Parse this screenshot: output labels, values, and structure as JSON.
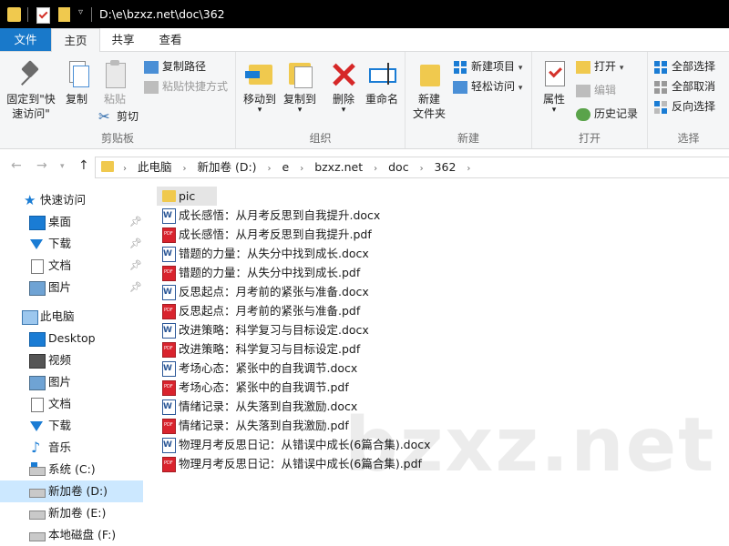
{
  "titlebar": {
    "path": "D:\\e\\bzxz.net\\doc\\362"
  },
  "tabs": [
    "文件",
    "主页",
    "共享",
    "查看"
  ],
  "ribbon": {
    "clipboard": {
      "label": "剪贴板",
      "pin": "固定到\"快\n速访问\"",
      "copy": "复制",
      "paste": "粘贴",
      "copy_path": "复制路径",
      "paste_shortcut": "粘贴快捷方式",
      "cut": "剪切"
    },
    "organize": {
      "label": "组织",
      "move_to": "移动到",
      "copy_to": "复制到",
      "delete": "删除",
      "rename": "重命名"
    },
    "new": {
      "label": "新建",
      "new_folder": "新建\n文件夹",
      "new_item": "新建项目",
      "easy_access": "轻松访问"
    },
    "open": {
      "label": "打开",
      "properties": "属性",
      "open": "打开",
      "edit": "编辑",
      "history": "历史记录"
    },
    "select": {
      "label": "选择",
      "select_all": "全部选择",
      "select_none": "全部取消",
      "invert": "反向选择"
    }
  },
  "breadcrumbs": [
    "此电脑",
    "新加卷 (D:)",
    "e",
    "bzxz.net",
    "doc",
    "362"
  ],
  "navpane": {
    "quick_access": "快速访问",
    "quick_items": [
      "桌面",
      "下载",
      "文档",
      "图片"
    ],
    "this_pc": "此电脑",
    "pc_items": [
      "Desktop",
      "视频",
      "图片",
      "文档",
      "下载",
      "音乐",
      "系统 (C:)",
      "新加卷 (D:)",
      "新加卷 (E:)",
      "本地磁盘 (F:)"
    ]
  },
  "files": [
    {
      "name": "pic",
      "type": "folder"
    },
    {
      "name": "成长感悟：从月考反思到自我提升.docx",
      "type": "docx"
    },
    {
      "name": "成长感悟：从月考反思到自我提升.pdf",
      "type": "pdf"
    },
    {
      "name": "错题的力量：从失分中找到成长.docx",
      "type": "docx"
    },
    {
      "name": "错题的力量：从失分中找到成长.pdf",
      "type": "pdf"
    },
    {
      "name": "反思起点：月考前的紧张与准备.docx",
      "type": "docx"
    },
    {
      "name": "反思起点：月考前的紧张与准备.pdf",
      "type": "pdf"
    },
    {
      "name": "改进策略：科学复习与目标设定.docx",
      "type": "docx"
    },
    {
      "name": "改进策略：科学复习与目标设定.pdf",
      "type": "pdf"
    },
    {
      "name": "考场心态：紧张中的自我调节.docx",
      "type": "docx"
    },
    {
      "name": "考场心态：紧张中的自我调节.pdf",
      "type": "pdf"
    },
    {
      "name": "情绪记录：从失落到自我激励.docx",
      "type": "docx"
    },
    {
      "name": "情绪记录：从失落到自我激励.pdf",
      "type": "pdf"
    },
    {
      "name": "物理月考反思日记：从错误中成长(6篇合集).docx",
      "type": "docx"
    },
    {
      "name": "物理月考反思日记：从错误中成长(6篇合集).pdf",
      "type": "pdf"
    }
  ],
  "watermark": "bzxz.net",
  "colors": {
    "accent": "#1979ca",
    "selection": "#cce8ff",
    "folder": "#f0c94e",
    "pdf": "#d9232d"
  }
}
